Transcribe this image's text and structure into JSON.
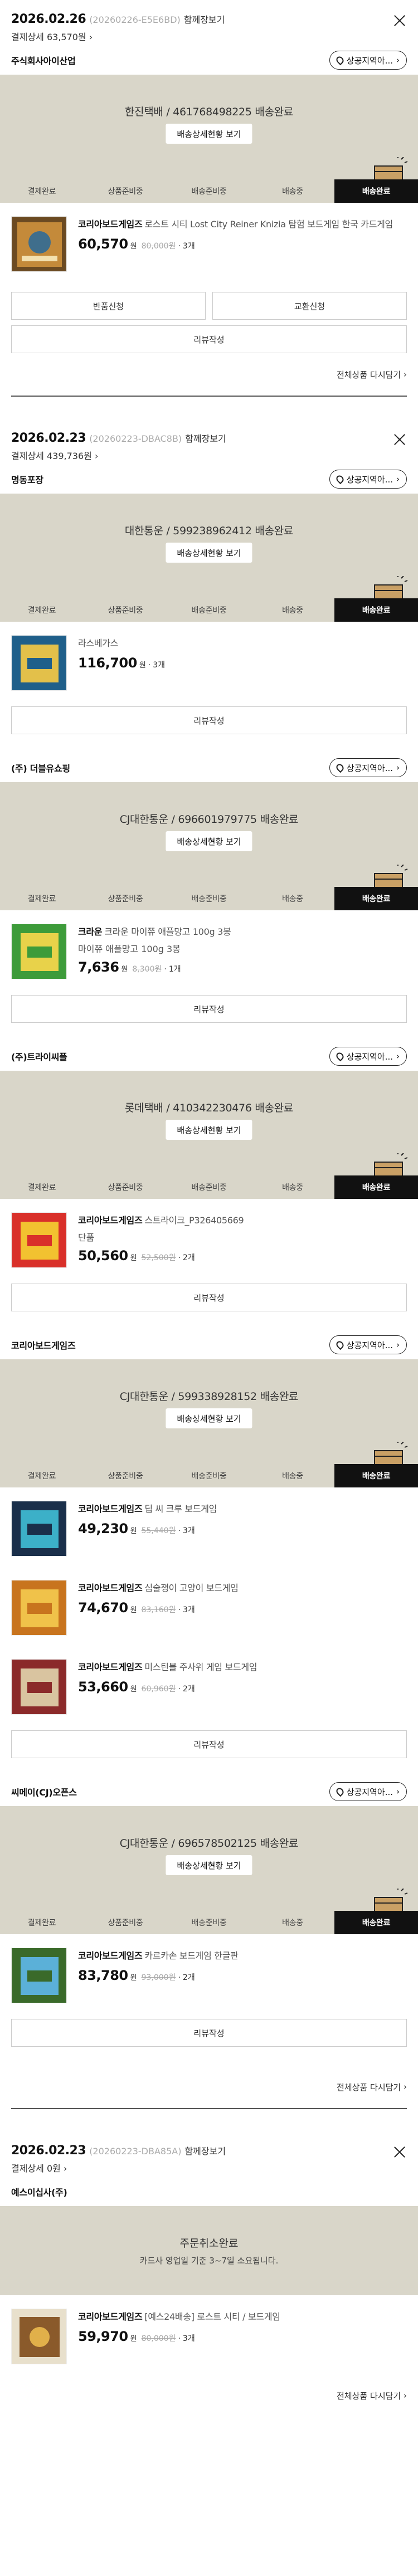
{
  "labels": {
    "with_order": "함께장보기",
    "origin": "상공지역아...",
    "track": "배송상세현황 보기",
    "review": "리뷰작성",
    "return": "반품신청",
    "exchange": "교환신청",
    "reorder": "전체상품 다시담기",
    "won": "원",
    "qty_sep": "·",
    "steps": [
      "결제완료",
      "상품준비중",
      "배송준비중",
      "배송중",
      "배송완료"
    ]
  },
  "orders": [
    {
      "date": "2026.02.26",
      "order_no": "(20260226-E5E6BD)",
      "pay": "결제상세 63,570원",
      "sellers": [
        {
          "name": "주식회사아이산업",
          "status": "한진택배 / 461768498225 배송완료",
          "items": [
            {
              "brand": "코리아보드게임즈",
              "title": "로스트 시티 Lost City Reiner Knizia 탐험 보드게임 한국 카드게임",
              "price": "60,570",
              "orig": "80,000원",
              "qty": "3개"
            }
          ],
          "has_return": true
        }
      ]
    },
    {
      "date": "2026.02.23",
      "order_no": "(20260223-DBAC8B)",
      "pay": "결제상세 439,736원",
      "sellers": [
        {
          "name": "명동포장",
          "status": "대한통운 / 599238962412 배송완료",
          "items": [
            {
              "brand": "",
              "title": "라스베가스",
              "price": "116,700",
              "orig": "",
              "qty": "3개"
            }
          ]
        },
        {
          "name": "(주) 더블유쇼핑",
          "status": "CJ대한통운 / 696601979775 배송완료",
          "items": [
            {
              "brand": "크라운",
              "title": "크라운 마이쮸 애플망고 100g 3봉",
              "opt": "마이쮸 애플망고 100g 3봉",
              "price": "7,636",
              "orig": "8,300원",
              "qty": "1개"
            }
          ]
        },
        {
          "name": "(주)트라이씨플",
          "status": "롯데택배 / 410342230476 배송완료",
          "items": [
            {
              "brand": "코리아보드게임즈",
              "title": "스트라이크_P326405669",
              "opt": "단품",
              "price": "50,560",
              "orig": "52,500원",
              "qty": "2개"
            }
          ]
        },
        {
          "name": "코리아보드게임즈",
          "status": "CJ대한통운 / 599338928152 배송완료",
          "items": [
            {
              "brand": "코리아보드게임즈",
              "title": "딥 씨 크루 보드게임",
              "price": "49,230",
              "orig": "55,440원",
              "qty": "3개"
            },
            {
              "brand": "코리아보드게임즈",
              "title": "심술쟁이 고양이 보드게임",
              "price": "74,670",
              "orig": "83,160원",
              "qty": "3개"
            },
            {
              "brand": "코리아보드게임즈",
              "title": "미스틴블 주사위 게임 보드게임",
              "price": "53,660",
              "orig": "60,960원",
              "qty": "2개"
            }
          ]
        },
        {
          "name": "씨메이(CJ)오픈스",
          "status": "CJ대한통운 / 696578502125 배송완료",
          "items": [
            {
              "brand": "코리아보드게임즈",
              "title": "카르카손 보드게임 한글판",
              "price": "83,780",
              "orig": "93,000원",
              "qty": "2개"
            }
          ]
        }
      ]
    },
    {
      "date": "2026.02.23",
      "order_no": "(20260223-DBA85A)",
      "pay": "결제상세 0원",
      "sellers": [
        {
          "name": "예스이십사(주)",
          "cancel": true,
          "cancel_title": "주문취소완료",
          "cancel_sub": "카드사 영업일 기준 3~7일 소요됩니다.",
          "items": [
            {
              "brand": "코리아보드게임즈",
              "title": "[예스24배송] 로스트 시티 / 보드게임",
              "price": "59,970",
              "orig": "80,000원",
              "qty": "3개"
            }
          ]
        }
      ]
    }
  ],
  "colors": {
    "banner": "#d9d6c9",
    "active_step": "#111111"
  }
}
